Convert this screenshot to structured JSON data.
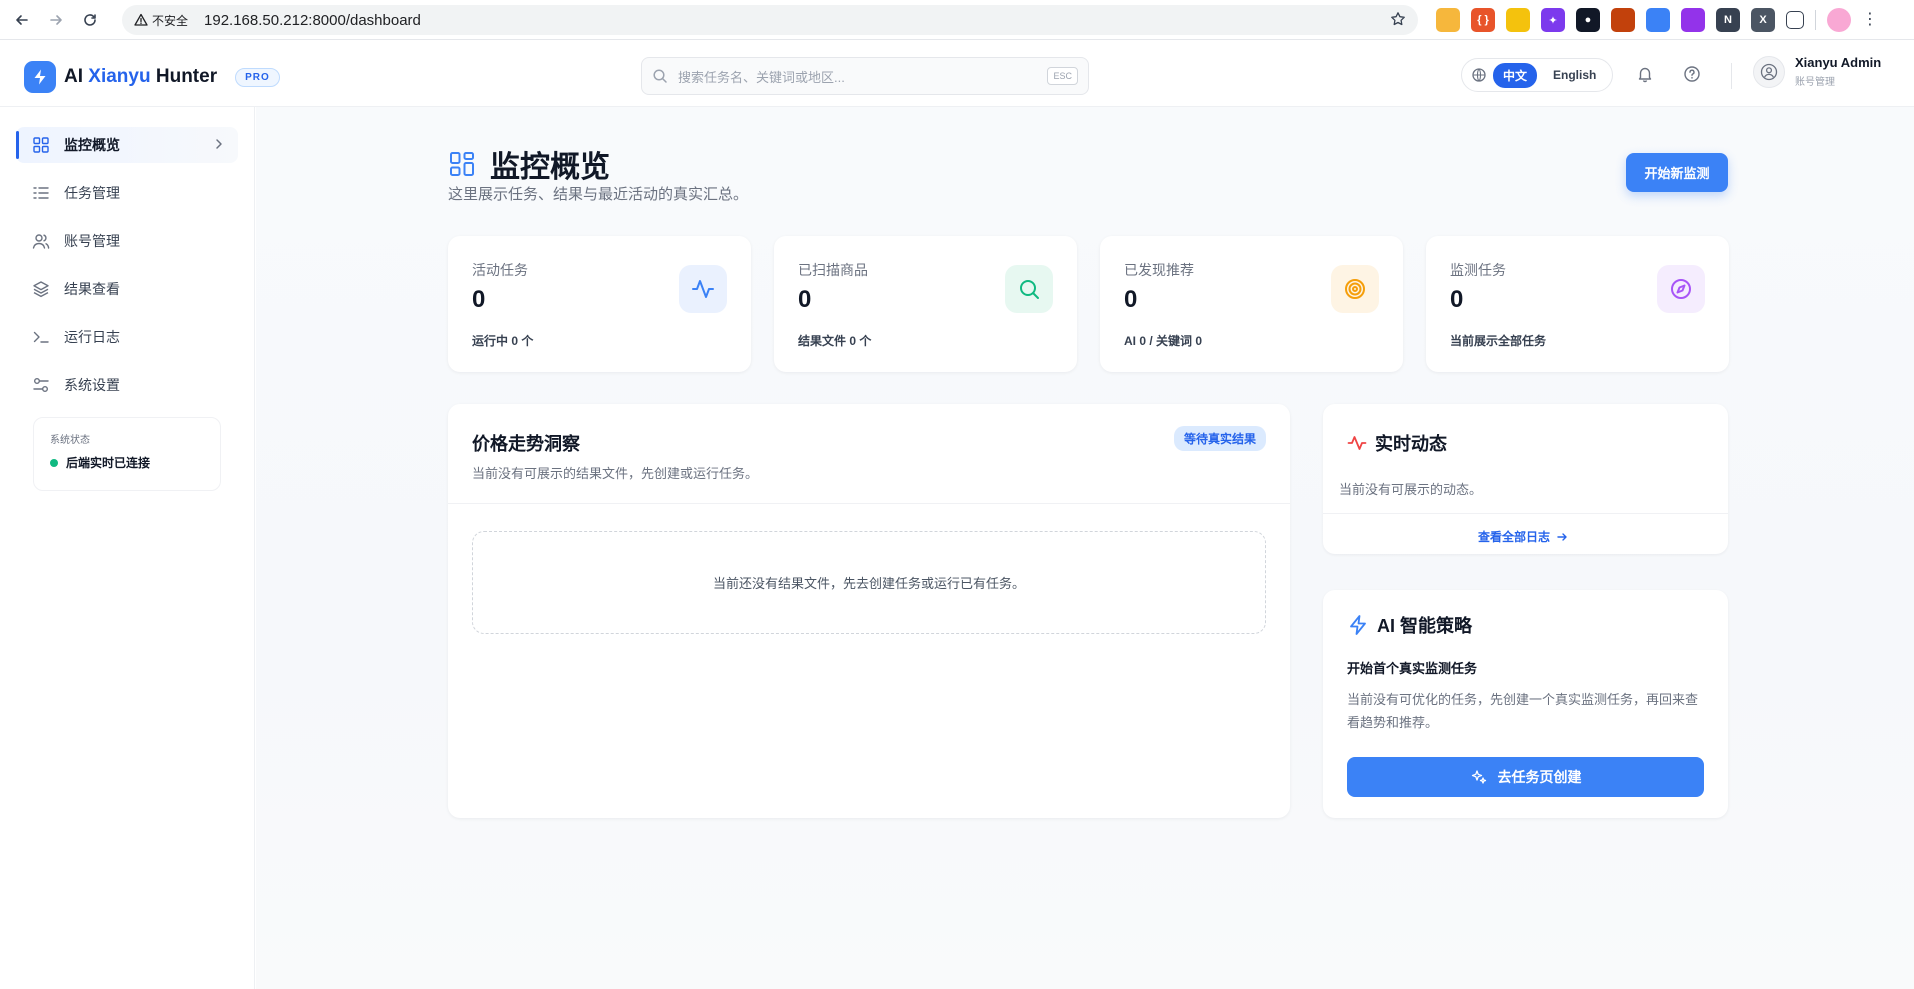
{
  "browser": {
    "insecure_label": "不安全",
    "url": "192.168.50.212:8000/dashboard"
  },
  "header": {
    "brand_ai": "AI",
    "brand_xianyu": "Xianyu",
    "brand_hunter": "Hunter",
    "badge": "PRO",
    "search_placeholder": "搜索任务名、关键词或地区...",
    "search_shortcut": "ESC",
    "lang_zh": "中文",
    "lang_en": "English",
    "user_name": "Xianyu Admin",
    "user_sub": "账号管理"
  },
  "sidebar": {
    "items": [
      {
        "label": "监控概览",
        "icon": "grid-icon"
      },
      {
        "label": "任务管理",
        "icon": "list-icon"
      },
      {
        "label": "账号管理",
        "icon": "users-icon"
      },
      {
        "label": "结果查看",
        "icon": "layers-icon"
      },
      {
        "label": "运行日志",
        "icon": "terminal-icon"
      },
      {
        "label": "系统设置",
        "icon": "sliders-icon"
      }
    ],
    "status_title": "系统状态",
    "status_text": "后端实时已连接"
  },
  "page": {
    "title": "监控概览",
    "subtitle": "这里展示任务、结果与最近活动的真实汇总。",
    "new_button": "开始新监测"
  },
  "stats": [
    {
      "label": "活动任务",
      "value": "0",
      "foot": "运行中 0 个",
      "icon": "activity-icon",
      "color": "#3b82f6",
      "bg": "#eaf1fe"
    },
    {
      "label": "已扫描商品",
      "value": "0",
      "foot": "结果文件 0 个",
      "icon": "search-icon",
      "color": "#10b981",
      "bg": "#e7f8f1"
    },
    {
      "label": "已发现推荐",
      "value": "0",
      "foot": "AI 0 / 关键词 0",
      "icon": "target-icon",
      "color": "#f59e0b",
      "bg": "#fef4e4"
    },
    {
      "label": "监测任务",
      "value": "0",
      "foot": "当前展示全部任务",
      "icon": "compass-icon",
      "color": "#a855f7",
      "bg": "#f5edfe"
    }
  ],
  "price_trend": {
    "title": "价格走势洞察",
    "badge": "等待真实结果",
    "subtitle": "当前没有可展示的结果文件，先创建或运行任务。",
    "empty": "当前还没有结果文件，先去创建任务或运行已有任务。"
  },
  "realtime": {
    "title": "实时动态",
    "empty": "当前没有可展示的动态。",
    "link": "查看全部日志"
  },
  "ai_strategy": {
    "title": "AI 智能策略",
    "heading": "开始首个真实监测任务",
    "desc": "当前没有可优化的任务，先创建一个真实监测任务，再回来查看趋势和推荐。",
    "button": "去任务页创建"
  }
}
